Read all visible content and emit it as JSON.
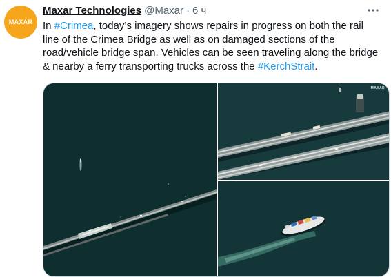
{
  "author": {
    "avatar_text": "MAXAR",
    "name": "Maxar Technologies",
    "handle": "@Maxar",
    "separator": "·",
    "time": "6 ч"
  },
  "more_icon": "more-horizontal-icon",
  "text": {
    "part1": "In ",
    "hashtag1": "#Crimea",
    "part2": ", today’s imagery shows repairs in progress on both the rail line of the Crimea Bridge as well as on damaged sections of the road/vehicle bridge span. Vehicles can be seen traveling along the bridge & nearby a ferry transporting trucks across the ",
    "hashtag2": "#KerchStrait",
    "part3": "."
  },
  "media": {
    "watermark": "MAXAR"
  },
  "colors": {
    "avatar": "#f5a61d",
    "link": "#1d9bf0",
    "water_left": "#0f3032",
    "water_right": "#173b3d"
  }
}
